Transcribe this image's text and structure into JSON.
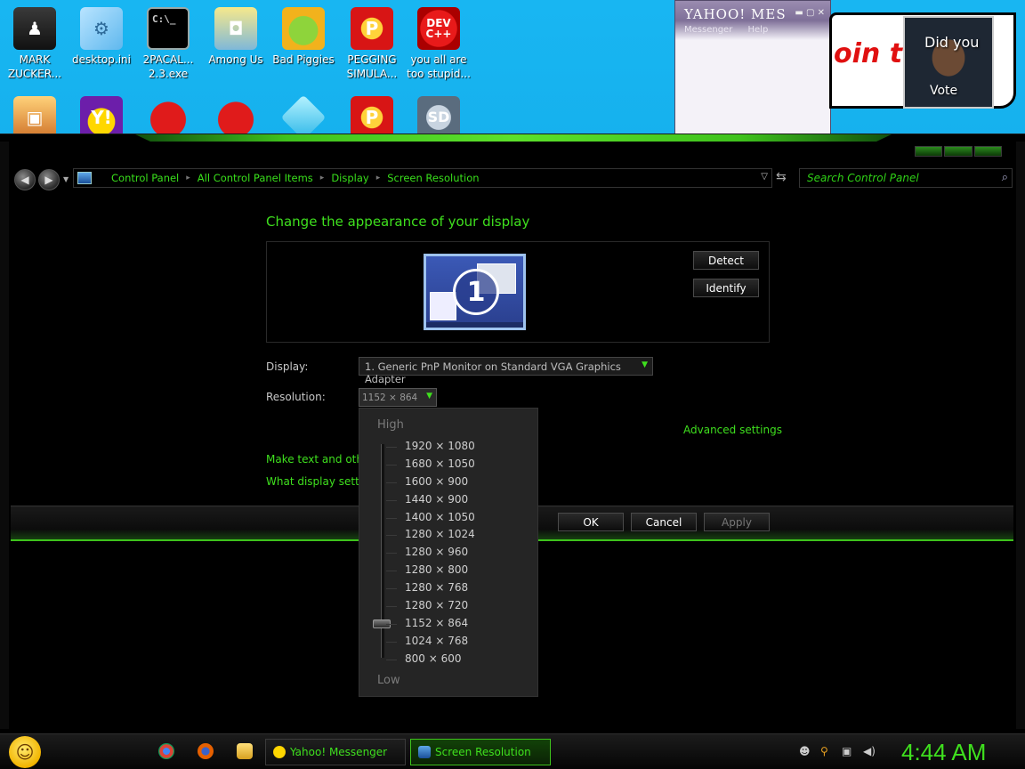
{
  "desktop": {
    "icons_row1": [
      {
        "label": "MARK\nZUCKER...",
        "icon": "person-icon"
      },
      {
        "label": "desktop.ini",
        "icon": "ini-file-icon"
      },
      {
        "label": "2PACAL...\n2.3.exe",
        "icon": "console-icon",
        "glyph": "C:\\_"
      },
      {
        "label": "Among Us",
        "icon": "among-us-icon"
      },
      {
        "label": "Bad Piggies",
        "icon": "bad-piggies-icon"
      },
      {
        "label": "PEGGING\nSIMULA...",
        "icon": "pegging-icon",
        "glyph": "P"
      },
      {
        "label": "you all are\ntoo stupid...",
        "icon": "devcpp-icon",
        "glyph": "DEV\nC++"
      }
    ],
    "icons_row2": [
      {
        "icon": "toolbox-icon"
      },
      {
        "icon": "yahoo-icon",
        "glyph": "Y!"
      },
      {
        "icon": "angry-birds-icon"
      },
      {
        "icon": "angry-birds-icon-2"
      },
      {
        "icon": "gem-icon"
      },
      {
        "icon": "pegging-icon-2",
        "glyph": "P"
      },
      {
        "icon": "sd-icon",
        "glyph": "SD"
      }
    ]
  },
  "yahoo_window": {
    "title": "YAHOO! MES",
    "menu": [
      "Messenger",
      "Help"
    ]
  },
  "paint_window": {
    "text": "oin ti",
    "photo_text_top": "Did you",
    "photo_text_bottom": "Vote"
  },
  "nav": {
    "breadcrumbs": [
      "Control Panel",
      "All Control Panel Items",
      "Display",
      "Screen Resolution"
    ],
    "search_placeholder": "Search Control Panel"
  },
  "content": {
    "title": "Change the appearance of your display",
    "monitor_number": "1",
    "detect_label": "Detect",
    "identify_label": "Identify",
    "display_label": "Display:",
    "display_value": "1. Generic PnP Monitor on Standard VGA Graphics Adapter",
    "resolution_label": "Resolution:",
    "resolution_value": "1152 × 864",
    "advanced_link": "Advanced settings",
    "link_text_size": "Make text and other",
    "link_display_settings": "What display setting",
    "ok_label": "OK",
    "cancel_label": "Cancel",
    "apply_label": "Apply"
  },
  "resolution_popup": {
    "high_label": "High",
    "low_label": "Low",
    "options": [
      "1920 × 1080",
      "1680 × 1050",
      "1600 × 900",
      "1440 × 900",
      "1400 × 1050",
      "1280 × 1024",
      "1280 × 960",
      "1280 × 800",
      "1280 × 768",
      "1280 × 720",
      "1152 × 864",
      "1024 × 768",
      "800 × 600"
    ],
    "selected_index": 10
  },
  "taskbar": {
    "tasks": [
      {
        "label": "Yahoo! Messenger",
        "icon": "yahoo-messenger-icon"
      },
      {
        "label": "Screen Resolution",
        "icon": "screen-resolution-icon"
      }
    ],
    "clock": "4:44 AM"
  },
  "colors": {
    "accent": "#3fe01e",
    "desktop": "#12a0e0"
  }
}
